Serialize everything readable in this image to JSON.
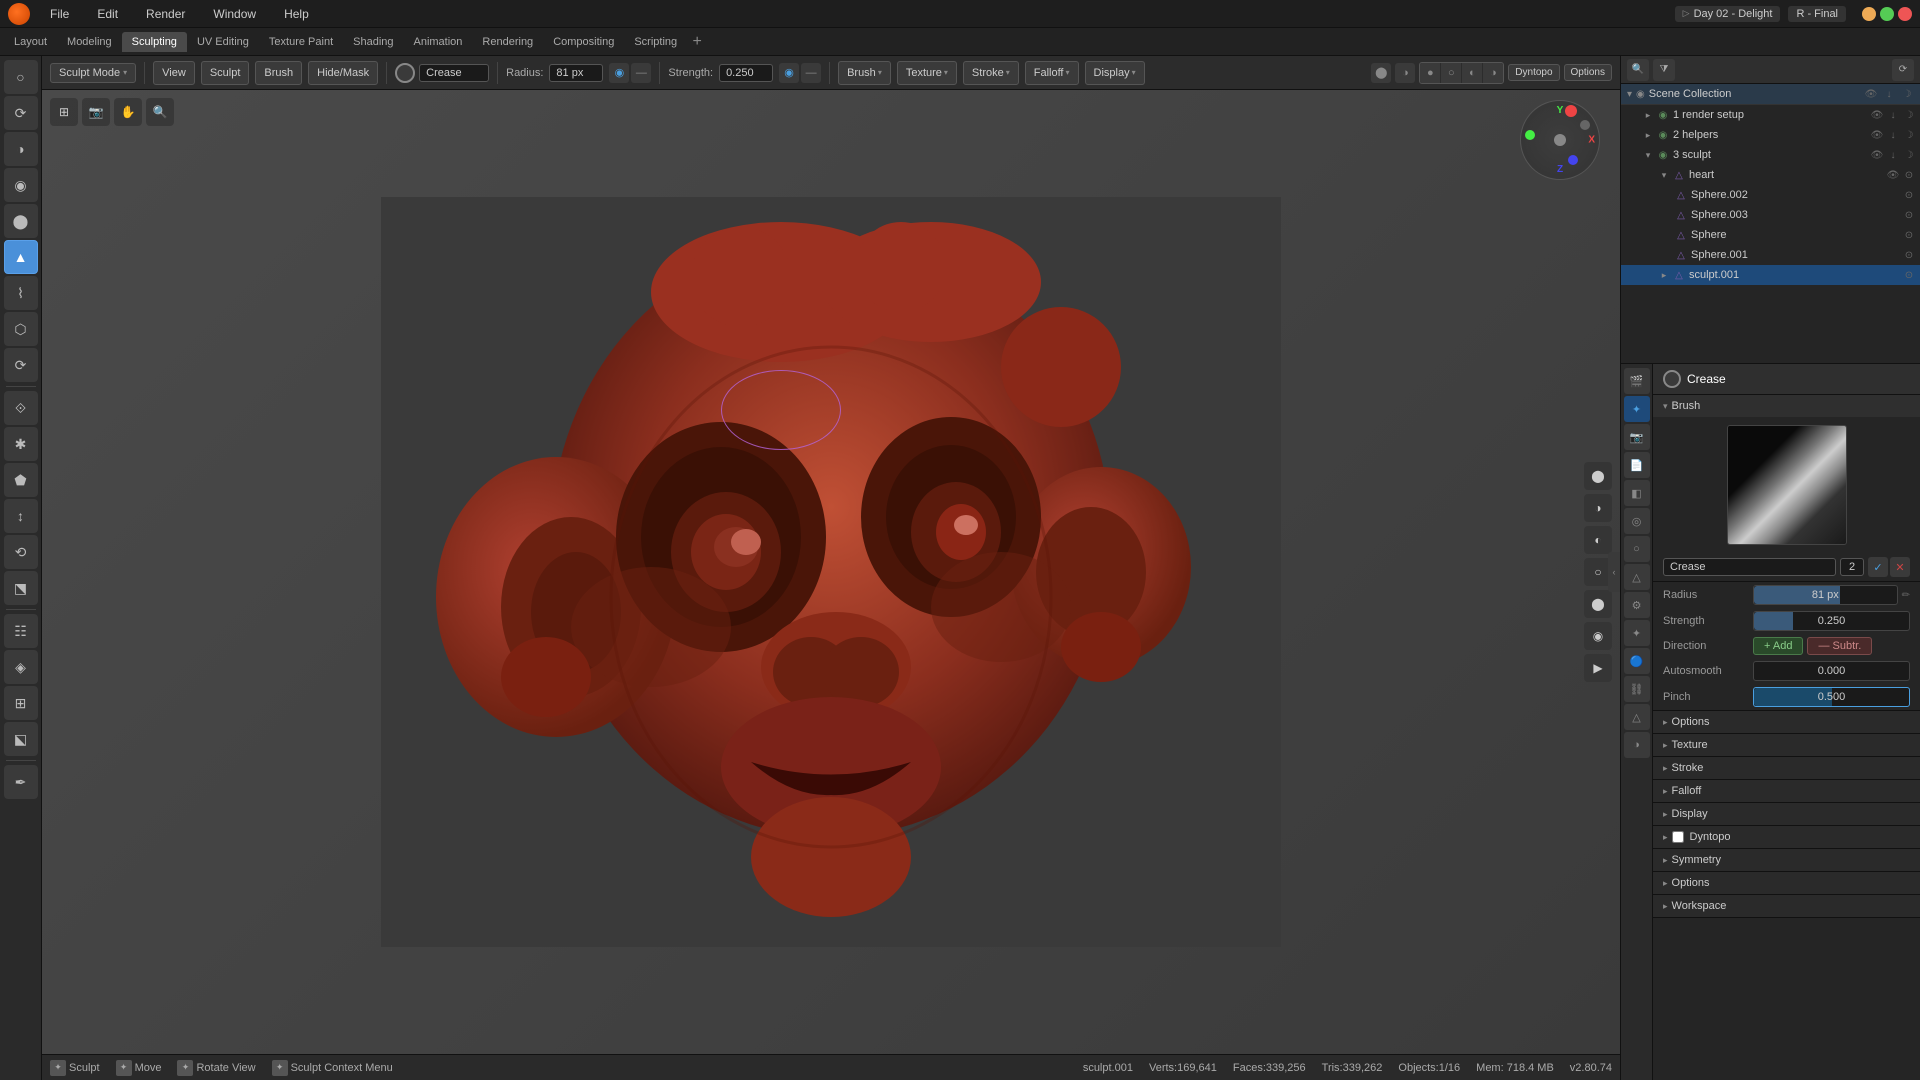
{
  "window": {
    "title1": "Day 02 - Delight",
    "title2": "R - Final"
  },
  "menubar": {
    "items": [
      "File",
      "Edit",
      "Render",
      "Window",
      "Help"
    ]
  },
  "workspace_tabs": {
    "tabs": [
      "Layout",
      "Modeling",
      "Sculpting",
      "UV Editing",
      "Texture Paint",
      "Shading",
      "Animation",
      "Rendering",
      "Compositing",
      "Scripting"
    ],
    "active": "Sculpting",
    "add_label": "+"
  },
  "top_toolbar": {
    "mode_label": "Sculpt Mode",
    "view_label": "View",
    "sculpt_label": "Sculpt",
    "brush_label": "Brush",
    "hidemask_label": "Hide/Mask",
    "brush_name": "Crease",
    "radius_label": "Radius:",
    "radius_value": "81 px",
    "strength_label": "Strength:",
    "strength_value": "0.250",
    "brush_dropdown": "Brush",
    "texture_dropdown": "Texture",
    "stroke_dropdown": "Stroke",
    "falloff_dropdown": "Falloff",
    "display_dropdown": "Display"
  },
  "left_tools": [
    {
      "icon": "○",
      "name": "draw-tool",
      "active": false
    },
    {
      "icon": "⟳",
      "name": "smooth-tool",
      "active": false
    },
    {
      "icon": "◫",
      "name": "pinch-tool",
      "active": false
    },
    {
      "icon": "◑",
      "name": "inflate-tool",
      "active": false
    },
    {
      "icon": "⬤",
      "name": "blob-tool",
      "active": false
    },
    {
      "icon": "▲",
      "name": "crease-tool",
      "active": true
    },
    {
      "icon": "⌇",
      "name": "flatten-tool",
      "active": false
    },
    {
      "icon": "⬡",
      "name": "fill-tool",
      "active": false
    },
    {
      "icon": "⟳",
      "name": "scrape-tool",
      "active": false
    },
    {
      "icon": "⟐",
      "name": "multiplane-tool",
      "active": false
    },
    {
      "icon": "✱",
      "name": "pinch-tool2",
      "active": false
    },
    {
      "icon": "⬟",
      "name": "grab-tool",
      "active": false
    },
    {
      "icon": "↕",
      "name": "snake-hook-tool",
      "active": false
    },
    {
      "icon": "⟲",
      "name": "thumb-tool",
      "active": false
    },
    {
      "icon": "⬔",
      "name": "pose-tool",
      "active": false
    },
    {
      "icon": "☷",
      "name": "nudge-tool",
      "active": false
    },
    {
      "icon": "◈",
      "name": "rotate-tool",
      "active": false
    },
    {
      "icon": "⊞",
      "name": "slide-relax-tool",
      "active": false
    },
    {
      "icon": "⬕",
      "name": "boundary-tool",
      "active": false
    },
    {
      "icon": "✒",
      "name": "annotate-tool",
      "active": false
    }
  ],
  "viewport": {
    "mesh_desc": "Sculpted face mesh in terracotta/dark red color"
  },
  "right_panel": {
    "scene_collection": "Scene Collection",
    "render_setup": "1 render setup",
    "helpers": "2 helpers",
    "sculpt_group": "3 sculpt",
    "heart": "heart",
    "sphere_002": "Sphere.002",
    "sphere_003": "Sphere.003",
    "sphere": "Sphere",
    "sphere_001": "Sphere.001",
    "sculpt_001": "sculpt.001"
  },
  "brush_properties": {
    "brush_title": "Brush",
    "crease_label": "Crease",
    "crease_num": "2",
    "radius_label": "Radius",
    "radius_value": "81 px",
    "strength_label": "Strength",
    "strength_value": "0.250",
    "direction_label": "Direction",
    "add_label": "+ Add",
    "sub_label": "— Subtr.",
    "autosmooth_label": "Autosmooth",
    "autosmooth_value": "0.000",
    "pinch_label": "Pinch",
    "pinch_value": "0.500"
  },
  "collapsible_sections": [
    {
      "label": "Options",
      "expanded": false
    },
    {
      "label": "Texture",
      "expanded": false
    },
    {
      "label": "Stroke",
      "expanded": false
    },
    {
      "label": "Falloff",
      "expanded": false
    },
    {
      "label": "Display",
      "expanded": false
    },
    {
      "label": "Dyntopo",
      "expanded": false,
      "checkbox": true
    },
    {
      "label": "Symmetry",
      "expanded": false
    },
    {
      "label": "Options",
      "expanded": false
    },
    {
      "label": "Workspace",
      "expanded": false
    }
  ],
  "status_bar": {
    "sculpt_label": "Sculpt",
    "move_label": "Move",
    "rotate_label": "Rotate View",
    "context_menu_label": "Sculpt Context Menu",
    "object_name": "sculpt.001",
    "verts": "Verts:169,641",
    "faces": "Faces:339,256",
    "tris": "Tris:339,262",
    "objects": "Objects:1/16",
    "mem": "Mem: 718.4 MB",
    "version": "v2.80.74"
  },
  "viewport_toolbar": {
    "dyntopo_label": "Dyntopo",
    "options_label": "Options"
  },
  "icons": {
    "chevron_down": "▾",
    "chevron_right": "▸",
    "eye": "👁",
    "collection": "◉",
    "mesh": "△",
    "expand": "▸",
    "collapse": "▾",
    "add": "+",
    "x": "✕",
    "camera": "📷",
    "sphere_icon": "○",
    "search": "🔍",
    "filter": "⧩",
    "pin": "📌",
    "grid": "⊞",
    "lock": "🔒"
  }
}
